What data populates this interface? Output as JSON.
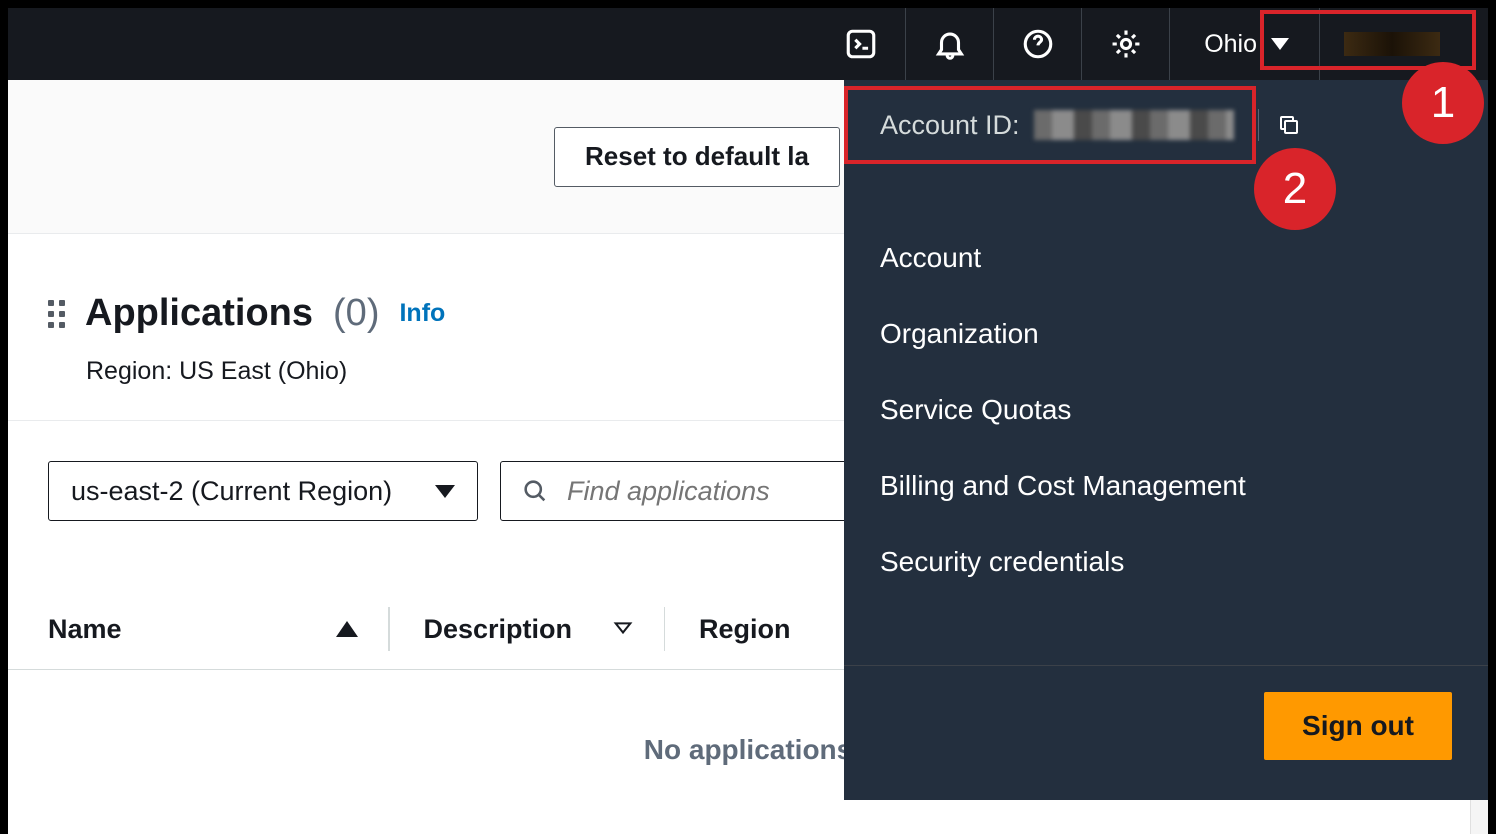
{
  "nav": {
    "region_label": "Ohio"
  },
  "toolbar": {
    "reset_label": "Reset to default la"
  },
  "apps": {
    "title": "Applications",
    "count": "(0)",
    "info_link": "Info",
    "region_line": "Region: US East (Ohio)"
  },
  "filters": {
    "region_select": "us-east-2 (Current Region)",
    "search_placeholder": "Find applications"
  },
  "table": {
    "columns": {
      "name": "Name",
      "description": "Description",
      "region": "Region"
    },
    "empty": "No applications"
  },
  "dropdown": {
    "account_id_label": "Account ID:",
    "items": [
      "Account",
      "Organization",
      "Service Quotas",
      "Billing and Cost Management",
      "Security credentials"
    ],
    "sign_out": "Sign out"
  },
  "annotations": {
    "callout_1": "1",
    "callout_2": "2"
  }
}
